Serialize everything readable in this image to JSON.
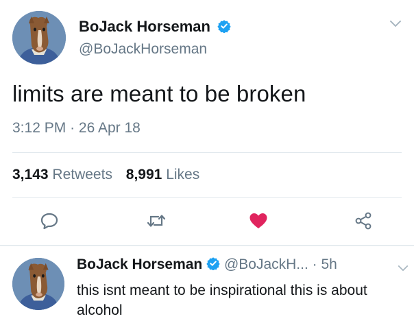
{
  "main_tweet": {
    "author_name": "BoJack Horseman",
    "author_handle": "@BoJackHorseman",
    "text": "limits are meant to be broken",
    "time": "3:12 PM",
    "separator": "·",
    "date": "26 Apr 18",
    "retweets_count": "3,143",
    "retweets_label": "Retweets",
    "likes_count": "8,991",
    "likes_label": "Likes",
    "liked": true
  },
  "reply": {
    "author_name": "BoJack Horseman",
    "author_handle": "@BoJackH...",
    "age": "· 5h",
    "text": "this isnt meant to be inspirational this is about alcohol"
  },
  "icons": {
    "verified": "verified-badge-icon",
    "menu": "chevron-down-icon",
    "reply": "reply-icon",
    "retweet": "retweet-icon",
    "like": "heart-icon",
    "share": "share-icon"
  },
  "colors": {
    "verified": "#1da1f2",
    "like": "#e0245e",
    "secondary_text": "#657786",
    "icon": "#657786"
  }
}
